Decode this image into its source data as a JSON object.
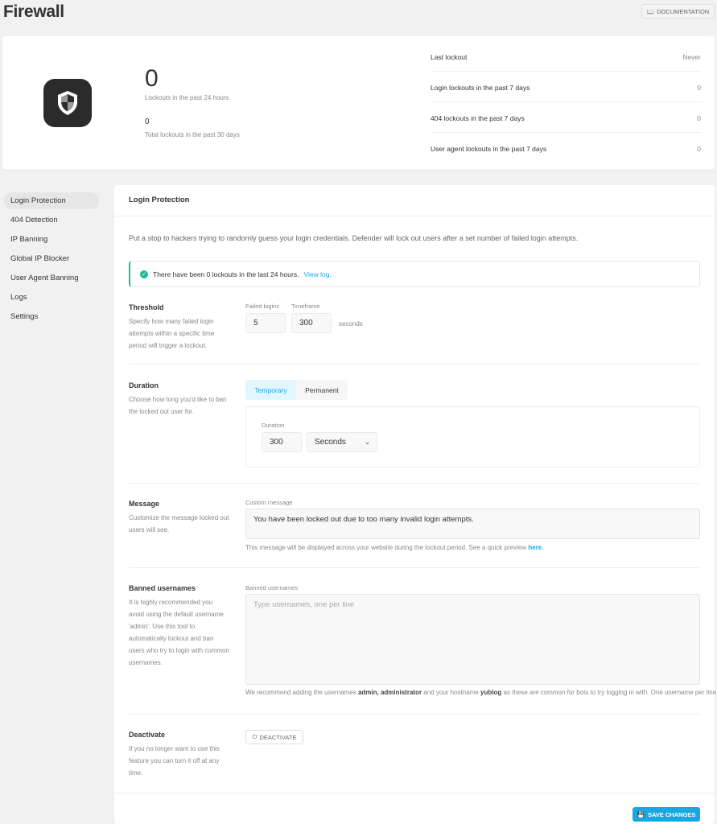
{
  "page": {
    "title": "Firewall",
    "documentation_label": "DOCUMENTATION"
  },
  "summary": {
    "lockouts_24h": "0",
    "lockouts_24h_label": "Lockouts in the past 24 hours",
    "lockouts_30d": "0",
    "lockouts_30d_label": "Total lockouts in the past 30 days",
    "stats": [
      {
        "label": "Last lockout",
        "value": "Never"
      },
      {
        "label": "Login lockouts in the past 7 days",
        "value": "0"
      },
      {
        "label": "404 lockouts in the past 7 days",
        "value": "0"
      },
      {
        "label": "User agent lockouts in the past 7 days",
        "value": "0"
      }
    ]
  },
  "sidebar": {
    "items": [
      {
        "label": "Login Protection",
        "active": true
      },
      {
        "label": "404 Detection"
      },
      {
        "label": "IP Banning"
      },
      {
        "label": "Global IP Blocker"
      },
      {
        "label": "User Agent Banning"
      },
      {
        "label": "Logs"
      },
      {
        "label": "Settings"
      }
    ]
  },
  "main": {
    "title": "Login Protection",
    "description": "Put a stop to hackers trying to randomly guess your login credentials. Defender will lock out users after a set number of failed login attempts.",
    "notice": {
      "text": "There have been 0 lockouts in the last 24 hours.",
      "link": "View log."
    },
    "threshold": {
      "title": "Threshold",
      "description": "Specify how many failed login attempts within a specific time period will trigger a lockout.",
      "failed_logins_label": "Failed logins",
      "failed_logins": "5",
      "timeframe_label": "Timeframe",
      "timeframe": "300",
      "unit": "seconds"
    },
    "duration": {
      "title": "Duration",
      "description": "Choose how long you'd like to ban the locked out user for.",
      "tabs": [
        "Temporary",
        "Permanent"
      ],
      "active_tab": "Temporary",
      "field_label": "Duration",
      "value": "300",
      "unit_select": "Seconds"
    },
    "message": {
      "title": "Message",
      "description": "Customize the message locked out users will see.",
      "field_label": "Custom message",
      "value": "You have been locked out due to too many invalid login attempts.",
      "help": "This message will be displayed across your website during the lockout period. See a quick preview",
      "help_link": "here."
    },
    "banned": {
      "title": "Banned usernames",
      "description": "It is highly recommended you avoid using the default username 'admin'. Use this tool to automatically lockout and ban users who try to login with common usernames.",
      "field_label": "Banned usernames",
      "placeholder": "Type usernames, one per line",
      "help_1": "We recommend adding the usernames",
      "help_b1": "admin, administrator",
      "help_2": "and your hostname",
      "help_b2": "yublog",
      "help_3": "as these are common for bots to try logging in with. One username per line"
    },
    "deactivate": {
      "title": "Deactivate",
      "description": "If you no longer want to use this feature you can turn it off at any time.",
      "button": "DEACTIVATE"
    },
    "save_label": "SAVE CHANGES"
  },
  "colors": {
    "accent": "#17a8e3",
    "success": "#1abc9c",
    "active_tab_bg": "#e1f6ff"
  }
}
